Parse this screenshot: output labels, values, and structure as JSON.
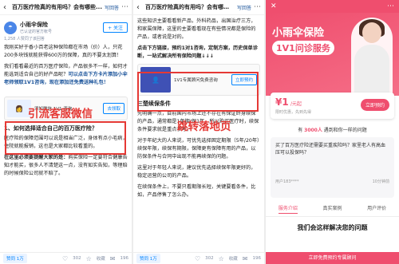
{
  "colors": {
    "zhihu_blue": "#0084ff",
    "annotation_red": "#e53935",
    "landing_pink": "#ef4e6e"
  },
  "panel1": {
    "title": "百万医疗险真的有用吗？会有哪些...",
    "write_answer": "写回答",
    "author_name": "小雨伞保险",
    "author_desc": "已认证的官方帐号",
    "follow": "+ 关注",
    "meta": "1,258 人赞同了该回答",
    "p1": "我刚买好于香小百老这种保险都在市场（价）人，只花200多块钱就能获得600万的保障，真的不要太划算！",
    "p2": "我们看看最近的百万医疗保险，产品很多不一样，如何才能选到适合自己的好产品呢？",
    "p2_highlight": "可以点击下方卡片添加小伞老师领取1V1咨询，现在添加还免费送种礼包！",
    "card_text": "添加微信 1V1 咨询",
    "card_button": "去领取",
    "annotation": "引流客服微信",
    "section1": "1、如何选择适合自己的百万医疗险？",
    "p3": "医疗险的保障范围可以说是相当广泛，身体有点小毛病，住院就能报销，这也是大家都比较看重的。",
    "p4_bold": "在这里必须要提醒大家的是：",
    "p4": "购买保险一定要符合健康告知才能买，很多人不清楚这一点，没有如实告知，等理赔的时候保险公司就不赔了。",
    "upvote": "赞同 1万",
    "comments": "196",
    "likes": "302",
    "favs": "收藏"
  },
  "panel2": {
    "title": "百万医疗险真的有用吗？会有哪些...",
    "write_answer": "写回答",
    "p1": "这些知识主要看看新产品，外科药品，出国治疗三方，和家属保障，这里的主要看看现在有些情况都是保险的产品，或者说是对的。",
    "p2_bold": "点击下方链接，预约1对1咨询，定制方案，历史保单诊断，一站式解决所有保险问题↓↓↓",
    "card_text": "1V1专属顾问免费咨询",
    "card_button": "立即预约",
    "section": "三楚续保条件",
    "p3": "先明确一点，目前国内市场上还不存在有保证终身续保的产品，通常都是1年期/保1年，所以购买医疗时，续保条件要求就是重点参考。",
    "p4": "对于年纪大的人来说，可优先选择固定期限（5年/20年）续保年限，续保有期限，保障更有保障有用的产品，以防保条件与合同中出现不能再续保的问题。",
    "p5": "这里对于年轻人来说，建议优先选择续保年限更好的，稳定运营的公司的产品。",
    "p6": "在续保条件上，不要只看期限长短，关键要看条件，比如，产品停售了怎么办。",
    "annotation": "跳转落地页",
    "upvote": "赞同 1万",
    "comments": "196",
    "likes": "302",
    "favs": "收藏"
  },
  "panel3": {
    "brand_line1": "小雨伞保险",
    "brand_line2": "1V1问诊服务",
    "price": "¥1",
    "price_unit": "/元起",
    "price_button": "立即预约",
    "price_note": "限时优惠，先到先得",
    "count_prefix": "有",
    "count_num": "3000人",
    "count_suffix": "遇到和你一样的问题",
    "question": "买了百万医疗险还需要买重疾险吗？家里老人有高血压可以投保吗？",
    "q_user": "用户183****",
    "q_time": "10分钟前",
    "tabs": [
      "服务介绍",
      "真实案例",
      "用户评价"
    ],
    "solve_title": "我们会这样解决您的问题",
    "cta": "立即免费预约专属顾问"
  }
}
